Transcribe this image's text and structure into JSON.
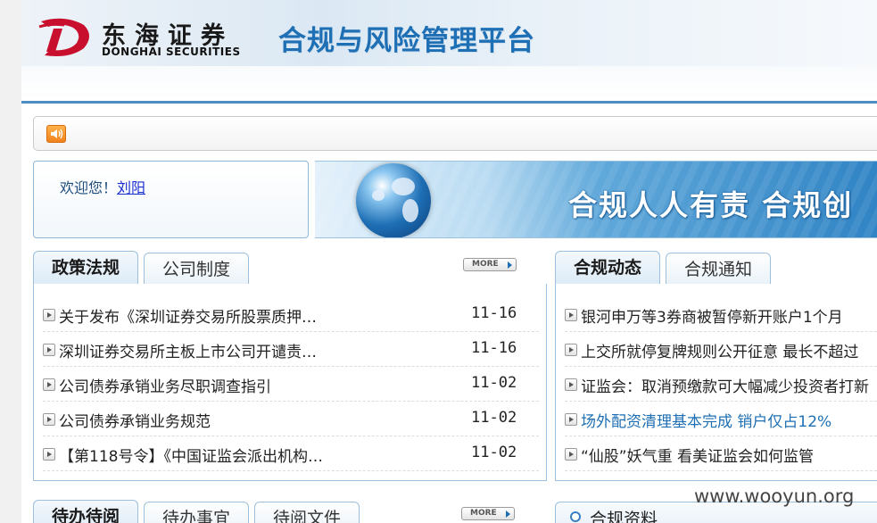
{
  "header": {
    "logo_cn": "东海证券",
    "logo_en": "DONGHAI SECURITIES",
    "platform_title": "合规与风险管理平台"
  },
  "welcome": {
    "greeting": "欢迎您！",
    "user_name": "刘阳"
  },
  "banner": {
    "slogan": "合规人人有责  合规创"
  },
  "policy_panel": {
    "tabs": [
      {
        "label": "政策法规",
        "active": true
      },
      {
        "label": "公司制度",
        "active": false
      }
    ],
    "more_label": "MORE",
    "items": [
      {
        "title": "关于发布《深圳证券交易所股票质押…",
        "date": "11-16"
      },
      {
        "title": "深圳证券交易所主板上市公司开谴责…",
        "date": "11-16"
      },
      {
        "title": "公司债券承销业务尽职调查指引",
        "date": "11-02"
      },
      {
        "title": "公司债券承销业务规范",
        "date": "11-02"
      },
      {
        "title": "【第118号令】《中国证监会派出机构…",
        "date": "11-02"
      }
    ]
  },
  "compliance_panel": {
    "tabs": [
      {
        "label": "合规动态",
        "active": true
      },
      {
        "label": "合规通知",
        "active": false
      }
    ],
    "items": [
      {
        "title": "银河申万等3券商被暂停新开账户1个月"
      },
      {
        "title": "上交所就停复牌规则公开征意 最长不超过"
      },
      {
        "title": "证监会：取消预缴款可大幅减少投资者打新"
      },
      {
        "title": "场外配资清理基本完成 销户仅占12%",
        "highlight": true
      },
      {
        "title": "“仙股”妖气重 看美证监会如何监管"
      }
    ]
  },
  "todo_panel": {
    "tabs": [
      {
        "label": "待办待阅",
        "active": true
      },
      {
        "label": "待办事宜",
        "active": false
      },
      {
        "label": "待阅文件",
        "active": false
      }
    ],
    "more_label": "MORE"
  },
  "materials_panel": {
    "label": "合规资料"
  },
  "watermark": "www.wooyun.org",
  "colors": {
    "accent_blue": "#1f6fb4",
    "panel_border": "#9cc0de",
    "link_blue": "#1a2fd0",
    "logo_red": "#c8102e"
  }
}
